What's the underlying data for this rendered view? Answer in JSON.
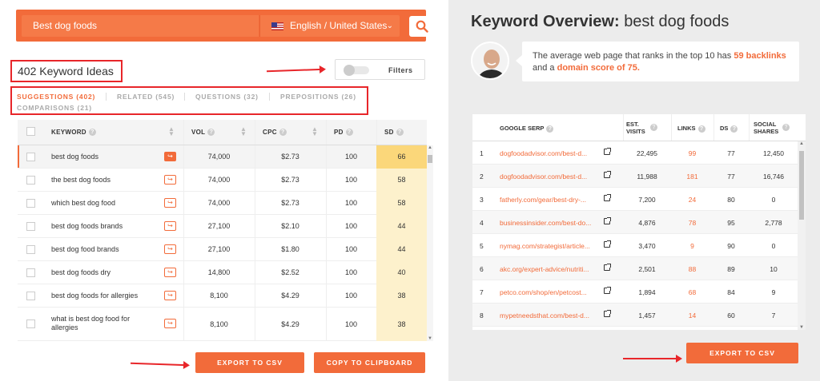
{
  "search": {
    "query": "Best dog foods",
    "language": "English / United States"
  },
  "ideas": {
    "title": "402 Keyword Ideas",
    "filters_label": "Filters"
  },
  "tabs": [
    {
      "label": "SUGGESTIONS (402)",
      "active": true
    },
    {
      "label": "RELATED (545)",
      "active": false
    },
    {
      "label": "QUESTIONS (32)",
      "active": false
    },
    {
      "label": "PREPOSITIONS (26)",
      "active": false
    },
    {
      "label": "COMPARISONS (21)",
      "active": false
    }
  ],
  "keyword_table": {
    "headers": {
      "keyword": "KEYWORD",
      "vol": "VOL",
      "cpc": "CPC",
      "pd": "PD",
      "sd": "SD"
    },
    "rows": [
      {
        "keyword": "best dog foods",
        "vol": "74,000",
        "cpc": "$2.73",
        "pd": "100",
        "sd": "66"
      },
      {
        "keyword": "the best dog foods",
        "vol": "74,000",
        "cpc": "$2.73",
        "pd": "100",
        "sd": "58"
      },
      {
        "keyword": "which best dog food",
        "vol": "74,000",
        "cpc": "$2.73",
        "pd": "100",
        "sd": "58"
      },
      {
        "keyword": "best dog foods brands",
        "vol": "27,100",
        "cpc": "$2.10",
        "pd": "100",
        "sd": "44"
      },
      {
        "keyword": "best dog food brands",
        "vol": "27,100",
        "cpc": "$1.80",
        "pd": "100",
        "sd": "44"
      },
      {
        "keyword": "best dog foods dry",
        "vol": "14,800",
        "cpc": "$2.52",
        "pd": "100",
        "sd": "40"
      },
      {
        "keyword": "best dog foods for allergies",
        "vol": "8,100",
        "cpc": "$4.29",
        "pd": "100",
        "sd": "38"
      },
      {
        "keyword": "what is best dog food for allergies",
        "vol": "8,100",
        "cpc": "$4.29",
        "pd": "100",
        "sd": "38"
      }
    ]
  },
  "left_buttons": {
    "export": "EXPORT TO CSV",
    "copy": "COPY TO CLIPBOARD"
  },
  "overview": {
    "title_bold": "Keyword Overview:",
    "title_keyword": "best dog foods",
    "bubble_pre": "The average web page that ranks in the top 10 has",
    "backlinks": "59 backlinks",
    "bubble_mid": "and a",
    "domain_score": "domain score of 75."
  },
  "serp_table": {
    "headers": {
      "serp": "GOOGLE SERP",
      "visits": "EST. VISITS",
      "links": "LINKS",
      "ds": "DS",
      "shares": "SOCIAL SHARES"
    },
    "rows": [
      {
        "rank": "1",
        "url": "dogfoodadvisor.com/best-d...",
        "visits": "22,495",
        "links": "99",
        "ds": "77",
        "shares": "12,450"
      },
      {
        "rank": "2",
        "url": "dogfoodadvisor.com/best-d...",
        "visits": "11,988",
        "links": "181",
        "ds": "77",
        "shares": "16,746"
      },
      {
        "rank": "3",
        "url": "fatherly.com/gear/best-dry-...",
        "visits": "7,200",
        "links": "24",
        "ds": "80",
        "shares": "0"
      },
      {
        "rank": "4",
        "url": "businessinsider.com/best-do...",
        "visits": "4,876",
        "links": "78",
        "ds": "95",
        "shares": "2,778"
      },
      {
        "rank": "5",
        "url": "nymag.com/strategist/article...",
        "visits": "3,470",
        "links": "9",
        "ds": "90",
        "shares": "0"
      },
      {
        "rank": "6",
        "url": "akc.org/expert-advice/nutriti...",
        "visits": "2,501",
        "links": "88",
        "ds": "89",
        "shares": "10"
      },
      {
        "rank": "7",
        "url": "petco.com/shop/en/petcost...",
        "visits": "1,894",
        "links": "68",
        "ds": "84",
        "shares": "9"
      },
      {
        "rank": "8",
        "url": "mypetneedsthat.com/best-d...",
        "visits": "1,457",
        "links": "14",
        "ds": "60",
        "shares": "7"
      }
    ]
  },
  "right_buttons": {
    "export": "EXPORT TO CSV"
  },
  "colors": {
    "accent": "#f26b3a",
    "annotation_red": "#e8262a",
    "sd_strong": "#fbd77a",
    "sd_light": "#fdf1cc"
  }
}
